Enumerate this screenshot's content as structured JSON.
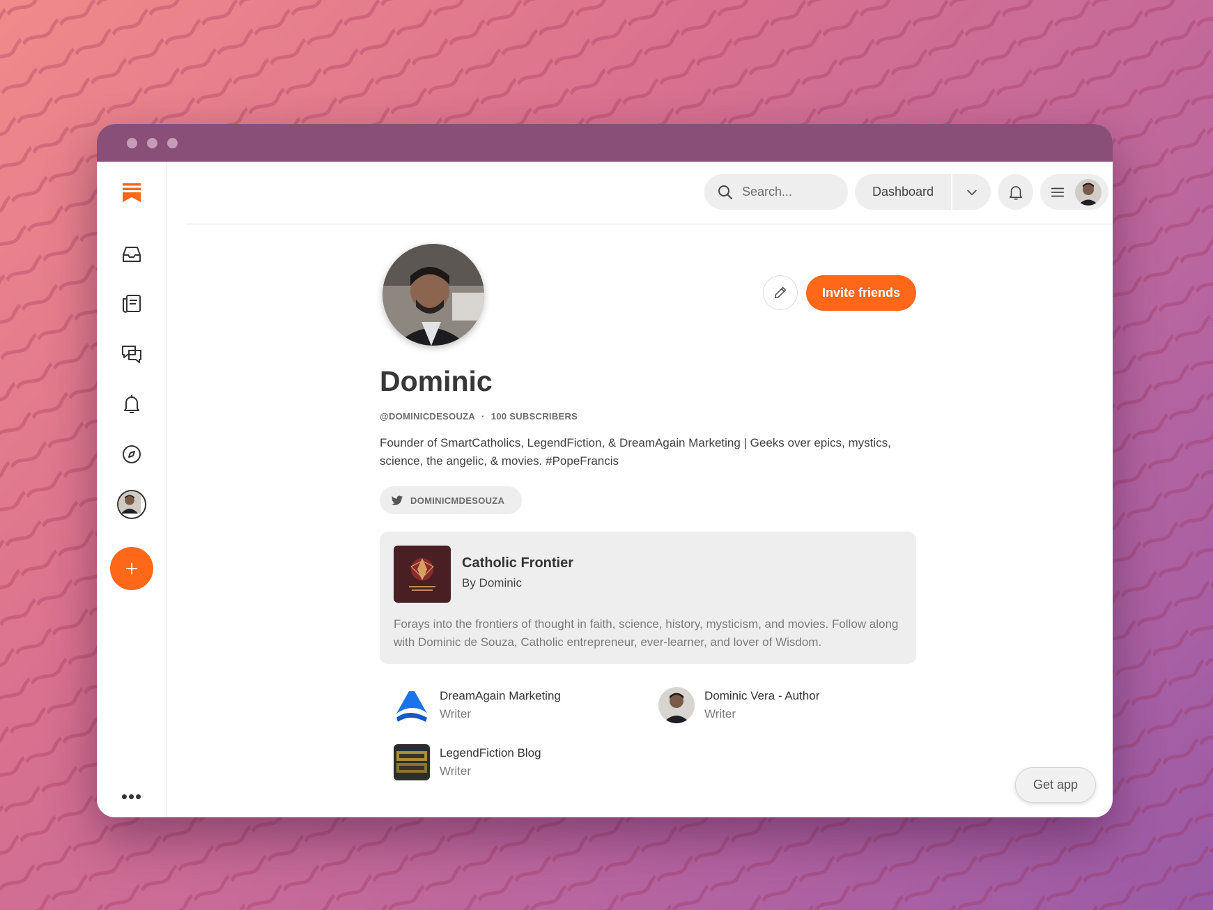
{
  "window": {
    "accent": "#ff6719",
    "titlebar_color": "#8a4f78"
  },
  "sidebar": {
    "items": [
      {
        "icon": "substack-logo-icon"
      },
      {
        "icon": "inbox-icon"
      },
      {
        "icon": "reader-icon"
      },
      {
        "icon": "chat-icon"
      },
      {
        "icon": "bell-icon"
      },
      {
        "icon": "compass-icon"
      },
      {
        "icon": "avatar"
      },
      {
        "icon": "plus-icon"
      },
      {
        "icon": "more-dots-icon"
      }
    ],
    "more": "•••"
  },
  "topbar": {
    "search_placeholder": "Search...",
    "dashboard_label": "Dashboard"
  },
  "profile": {
    "name": "Dominic",
    "handle": "@DOMINICDESOUZA",
    "separator": "·",
    "subscribers": "100 SUBSCRIBERS",
    "bio": "Founder of SmartCatholics, LegendFiction, & DreamAgain Marketing | Geeks over epics, mystics, science, the angelic, & movies. #PopeFrancis",
    "twitter": "DOMINICMDESOUZA",
    "invite_label": "Invite friends"
  },
  "featured": {
    "title": "Catholic Frontier",
    "by": "By Dominic",
    "description": "Forays into the frontiers of thought in faith, science, history, mysticism, and movies. Follow along with Dominic de Souza, Catholic entrepreneur, ever-learner, and lover of Wisdom."
  },
  "publications": [
    {
      "title": "DreamAgain Marketing",
      "role": "Writer"
    },
    {
      "title": "Dominic Vera - Author",
      "role": "Writer"
    },
    {
      "title": "LegendFiction Blog",
      "role": "Writer"
    }
  ],
  "get_app_label": "Get app"
}
